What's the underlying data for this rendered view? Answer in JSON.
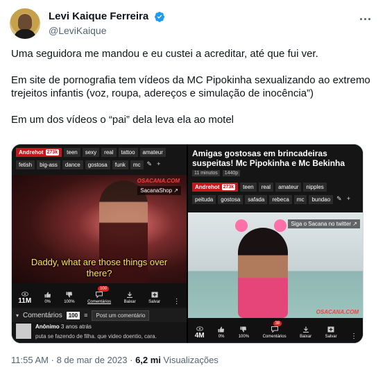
{
  "tweet": {
    "display_name": "Levi Kaique Ferreira",
    "handle": "@LeviKaique",
    "paragraphs": [
      "Uma seguidora me mandou e eu custei a acreditar, até que fui ver.",
      "Em site de pornografia tem vídeos da MC Pipokinha sexualizando ao extremo trejeitos infantis (voz, roupa, adereços e simulação de inocência”)",
      "Em um dos vídeos o “pai” dela leva ela ao motel"
    ],
    "time": "11:55 AM",
    "separator": "·",
    "date": "8 de mar de 2023",
    "views_count": "6,2 mi",
    "views_label": "Visualizações"
  },
  "left_pane": {
    "uploader": "Andrehot",
    "uploader_count": "273k",
    "tags_row1": [
      "teen",
      "sexy",
      "real",
      "tattoo",
      "amateur"
    ],
    "tags_row2": [
      "fetish",
      "big-ass",
      "dance",
      "gostosa",
      "funk",
      "mc"
    ],
    "watermark": "OSACANA.COM",
    "overlay": "SacanaShop",
    "subtitle_line1": "Daddy, what are those things over",
    "subtitle_line2": "there?",
    "views": "11M",
    "likes": "0%",
    "dislikes": "100%",
    "comments_badge": "100",
    "comments_label": "Comentários",
    "download_label": "Baixar",
    "save_label": "Salvar",
    "comments_bar_label": "Comentários",
    "comments_bar_count": "100",
    "post_comment": "Post um comentário",
    "comment_author": "Anônimo",
    "comment_age": "3 anos atrás",
    "comment_text": "puta se fazendo de filha. que video doentio, cara."
  },
  "right_pane": {
    "title": "Amigas gostosas em brincadeiras suspeitas! Mc Pipokinha e Mc Bekinha",
    "duration": "11 minutos",
    "quality": "1440p",
    "uploader": "Andrehot",
    "uploader_count": "273k",
    "tags_row1": [
      "teen",
      "real",
      "amateur",
      "nipples"
    ],
    "tags_row2": [
      "peituda",
      "gostosa",
      "safada",
      "rebeca",
      "mc",
      "bundao"
    ],
    "overlay": "Siga o Sacana no twitter",
    "watermark": "OSACANA.COM",
    "views": "4M",
    "likes": "0%",
    "dislikes": "100%",
    "comments_badge": "38",
    "comments_label": "Comentários",
    "download_label": "Baixar",
    "save_label": "Salvar"
  }
}
